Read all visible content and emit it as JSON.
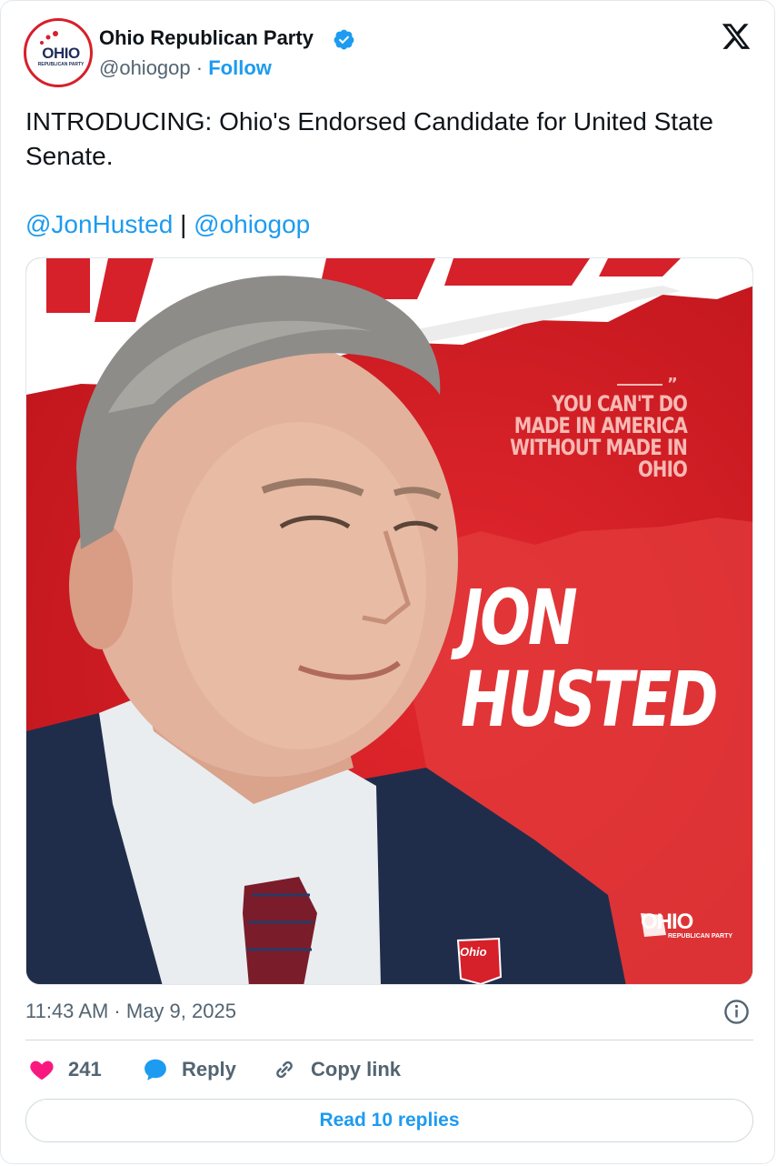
{
  "author": {
    "name": "Ohio Republican Party",
    "handle": "@ohiogop",
    "separator": "·",
    "follow_label": "Follow",
    "avatar_text": "OHIO",
    "avatar_subtext": "REPUBLICAN PARTY"
  },
  "tweet": {
    "text": "INTRODUCING: Ohio's Endorsed Candidate for United State Senate.",
    "mention_1": "@JonHusted",
    "mention_sep": "|",
    "mention_2": "@ohiogop"
  },
  "media": {
    "quote_lines": [
      "YOU CAN'T DO",
      "MADE IN AMERICA",
      "WITHOUT MADE IN",
      "OHIO"
    ],
    "name_line_1": "JON",
    "name_line_2": "HUSTED",
    "brand": "OHIO",
    "brand_sub": "REPUBLICAN PARTY",
    "pin_text": "Ohio"
  },
  "footer": {
    "timestamp": "11:43 AM · May 9, 2025",
    "likes_count": "241",
    "reply_label": "Reply",
    "copy_link_label": "Copy link",
    "read_replies_label": "Read 10 replies"
  },
  "colors": {
    "accent": "#1d9bf0",
    "like": "#f91880",
    "poster_red": "#d6202a",
    "suit_navy": "#1f2d4a"
  },
  "icons": [
    "verified-badge-icon",
    "x-logo-icon",
    "info-icon",
    "heart-icon",
    "reply-icon",
    "link-icon"
  ]
}
